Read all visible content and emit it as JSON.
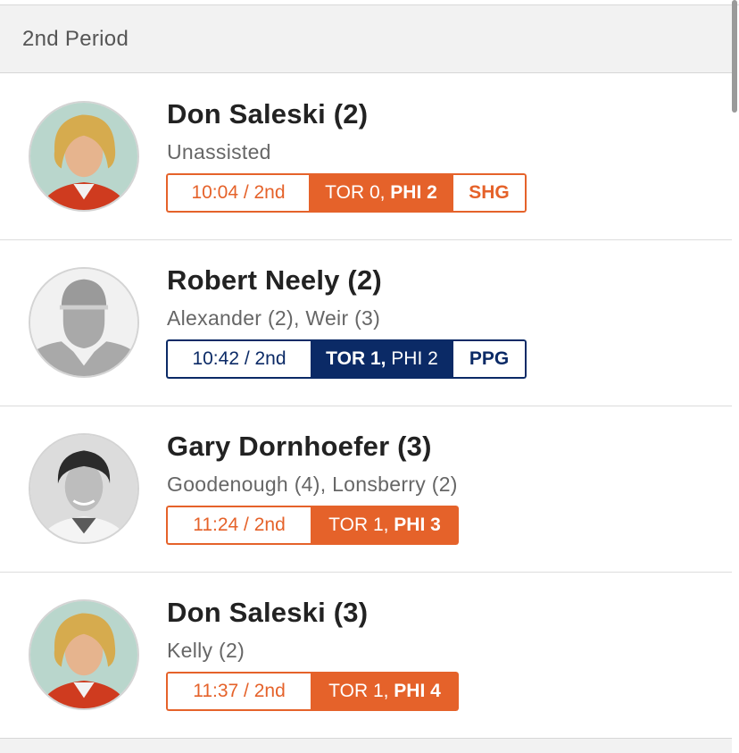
{
  "period": {
    "label": "2nd Period"
  },
  "colors": {
    "phi": "#e5622a",
    "tor": "#0b2a66"
  },
  "goals": [
    {
      "player": "Don Saleski (2)",
      "assists": "Unassisted",
      "time": "10:04 / 2nd",
      "score_tor": "TOR 0,",
      "score_phi": "PHI 2",
      "goal_type": "SHG",
      "team": "phi",
      "avatar": "photo-curly-blond"
    },
    {
      "player": "Robert Neely (2)",
      "assists": "Alexander (2), Weir (3)",
      "time": "10:42 / 2nd",
      "score_tor": "TOR 1,",
      "score_phi": "PHI 2",
      "goal_type": "PPG",
      "team": "tor",
      "avatar": "placeholder-silhouette"
    },
    {
      "player": "Gary Dornhoefer (3)",
      "assists": "Goodenough (4), Lonsberry (2)",
      "time": "11:24 / 2nd",
      "score_tor": "TOR 1,",
      "score_phi": "PHI 3",
      "goal_type": "",
      "team": "phi",
      "avatar": "photo-bw"
    },
    {
      "player": "Don Saleski (3)",
      "assists": "Kelly (2)",
      "time": "11:37 / 2nd",
      "score_tor": "TOR 1,",
      "score_phi": "PHI 4",
      "goal_type": "",
      "team": "phi",
      "avatar": "photo-curly-blond"
    }
  ]
}
